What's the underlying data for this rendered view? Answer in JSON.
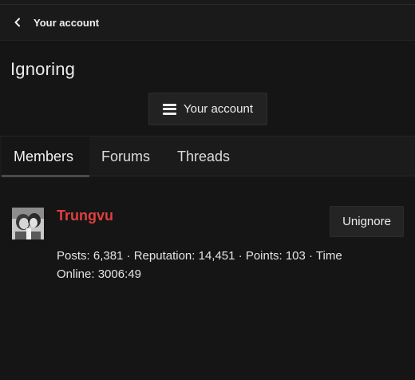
{
  "nav": {
    "back_label": "Your account"
  },
  "page": {
    "title": "Ignoring"
  },
  "menu": {
    "label": "Your account"
  },
  "tabs": [
    {
      "label": "Members",
      "active": true
    },
    {
      "label": "Forums",
      "active": false
    },
    {
      "label": "Threads",
      "active": false
    }
  ],
  "members": [
    {
      "username": "Trungvu",
      "stats_line1": "Posts: 6,381 · Reputation: 14,451 · Points: 103 · Time",
      "stats_line2": "Online: 3006:49",
      "action_label": "Unignore"
    }
  ],
  "colors": {
    "background": "#151515",
    "username": "#e03f3f"
  },
  "icons": {
    "back": "chevron-left-icon",
    "menu": "hamburger-icon"
  }
}
